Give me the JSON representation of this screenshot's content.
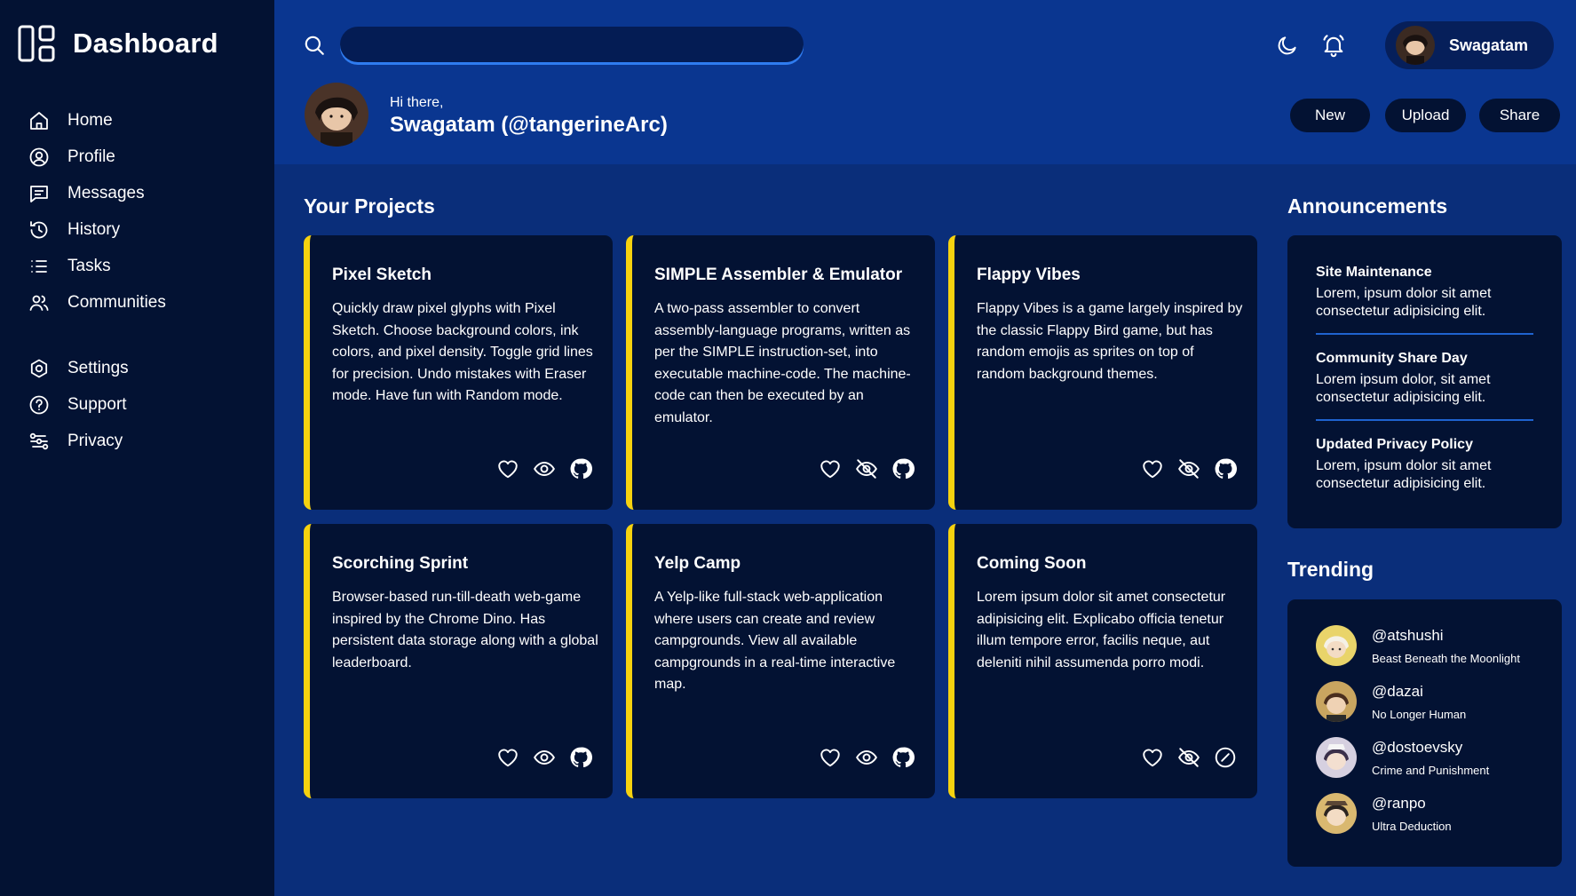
{
  "sidebar": {
    "title": "Dashboard",
    "items": [
      {
        "label": "Home",
        "icon": "home-icon"
      },
      {
        "label": "Profile",
        "icon": "user-circle-icon"
      },
      {
        "label": "Messages",
        "icon": "message-icon"
      },
      {
        "label": "History",
        "icon": "history-icon"
      },
      {
        "label": "Tasks",
        "icon": "list-icon"
      },
      {
        "label": "Communities",
        "icon": "users-icon"
      }
    ],
    "secondary": [
      {
        "label": "Settings",
        "icon": "gear-icon"
      },
      {
        "label": "Support",
        "icon": "help-circle-icon"
      },
      {
        "label": "Privacy",
        "icon": "privacy-icon"
      }
    ]
  },
  "header": {
    "search_placeholder": "",
    "user_name": "Swagatam",
    "greeting_small": "Hi there,",
    "greeting_name": "Swagatam (@tangerineArc)",
    "buttons": {
      "new": "New",
      "upload": "Upload",
      "share": "Share"
    }
  },
  "projects": {
    "title": "Your Projects",
    "items": [
      {
        "title": "Pixel Sketch",
        "description": "Quickly draw pixel glyphs with Pixel Sketch. Choose background colors, ink colors, and pixel density. Toggle grid lines for precision. Undo mistakes with Eraser mode. Have fun with Random mode.",
        "icons": [
          "heart-icon",
          "eye-icon",
          "github-icon"
        ]
      },
      {
        "title": "SIMPLE Assembler & Emulator",
        "description": "A two-pass assembler to convert assembly-language programs, written as per the SIMPLE instruction-set, into executable machine-code. The machine-code can then be executed by an emulator.",
        "icons": [
          "heart-icon",
          "eye-off-icon",
          "github-icon"
        ]
      },
      {
        "title": "Flappy Vibes",
        "description": "Flappy Vibes is a game largely inspired by the classic Flappy Bird game, but has random emojis as sprites on top of random background themes.",
        "icons": [
          "heart-icon",
          "eye-off-icon",
          "github-icon"
        ]
      },
      {
        "title": "Scorching Sprint",
        "description": "Browser-based run-till-death web-game inspired by the Chrome Dino. Has persistent data storage along with a global leaderboard.",
        "icons": [
          "heart-icon",
          "eye-icon",
          "github-icon"
        ]
      },
      {
        "title": "Yelp Camp",
        "description": "A Yelp-like full-stack web-application where users can create and review campgrounds. View all available campgrounds in a real-time interactive map.",
        "icons": [
          "heart-icon",
          "eye-icon",
          "github-icon"
        ]
      },
      {
        "title": "Coming Soon",
        "description": "Lorem ipsum dolor sit amet consectetur adipisicing elit. Explicabo officia tenetur illum tempore error, facilis neque, aut deleniti nihil assumenda porro modi.",
        "icons": [
          "heart-icon",
          "eye-off-icon",
          "no-entry-icon"
        ]
      }
    ]
  },
  "announcements": {
    "title": "Announcements",
    "items": [
      {
        "title": "Site Maintenance",
        "body": "Lorem, ipsum dolor sit amet consectetur adipisicing elit."
      },
      {
        "title": "Community Share Day",
        "body": "Lorem ipsum dolor, sit amet consectetur adipisicing elit."
      },
      {
        "title": "Updated Privacy Policy",
        "body": "Lorem, ipsum dolor sit amet consectetur adipisicing elit."
      }
    ]
  },
  "trending": {
    "title": "Trending",
    "items": [
      {
        "handle": "@atshushi",
        "subtitle": "Beast Beneath the Moonlight",
        "avatar_color": "#e9d46a"
      },
      {
        "handle": "@dazai",
        "subtitle": "No Longer Human",
        "avatar_color": "#c9a560"
      },
      {
        "handle": "@dostoevsky",
        "subtitle": "Crime and Punishment",
        "avatar_color": "#d6d0e0"
      },
      {
        "handle": "@ranpo",
        "subtitle": "Ultra Deduction",
        "avatar_color": "#d9b870"
      }
    ]
  },
  "colors": {
    "sidebar_bg": "#031233",
    "main_bg": "#0a2e7a",
    "header_bg": "#0a3690",
    "card_bg": "#031233",
    "accent_yellow": "#f6d20f",
    "divider_blue": "#1f63cf"
  }
}
